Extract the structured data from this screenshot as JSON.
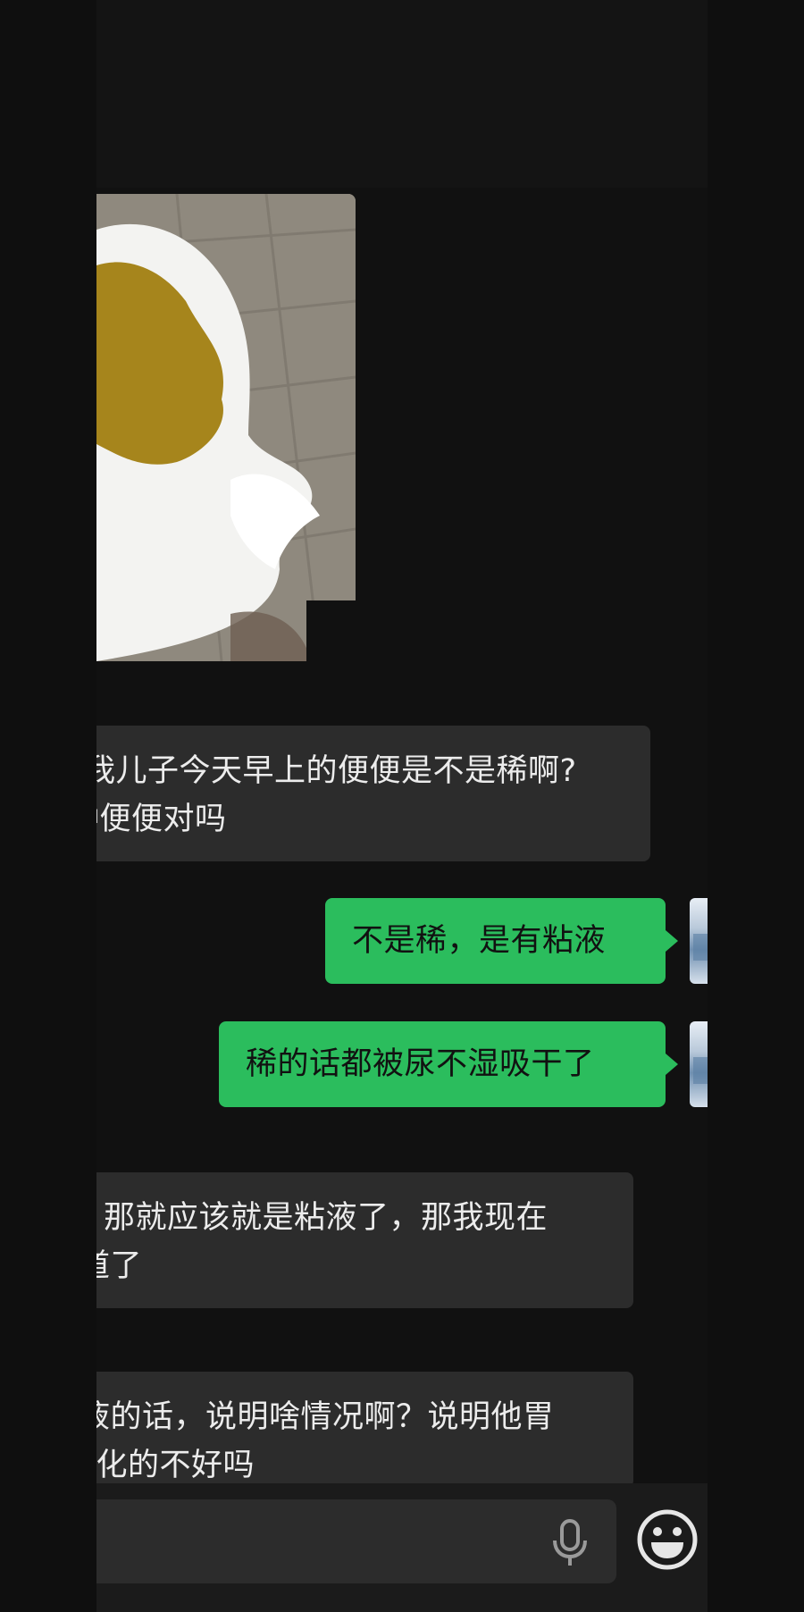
{
  "messages": [
    {
      "type": "image",
      "direction": "received",
      "alt": "photo"
    },
    {
      "type": "text",
      "direction": "received",
      "lines": [
        "我儿子今天早上的便便是不是稀啊?",
        "种便便对吗"
      ]
    },
    {
      "type": "text",
      "direction": "sent",
      "lines": [
        "不是稀，是有粘液"
      ]
    },
    {
      "type": "text",
      "direction": "sent",
      "lines": [
        "稀的话都被尿不湿吸干了"
      ]
    },
    {
      "type": "text",
      "direction": "received",
      "lines": [
        "那就应该就是粘液了，那我现在",
        "道了"
      ]
    },
    {
      "type": "text",
      "direction": "received",
      "lines": [
        "液的话，说明啥情况啊？说明他胃",
        "消化的不好吗"
      ]
    }
  ],
  "input": {
    "placeholder": ""
  },
  "icons": {
    "voice": "microphone-icon",
    "emoji": "emoji-icon"
  },
  "colors": {
    "background": "#111111",
    "received_bubble": "#2c2c2c",
    "sent_bubble": "#2bbd5d"
  }
}
